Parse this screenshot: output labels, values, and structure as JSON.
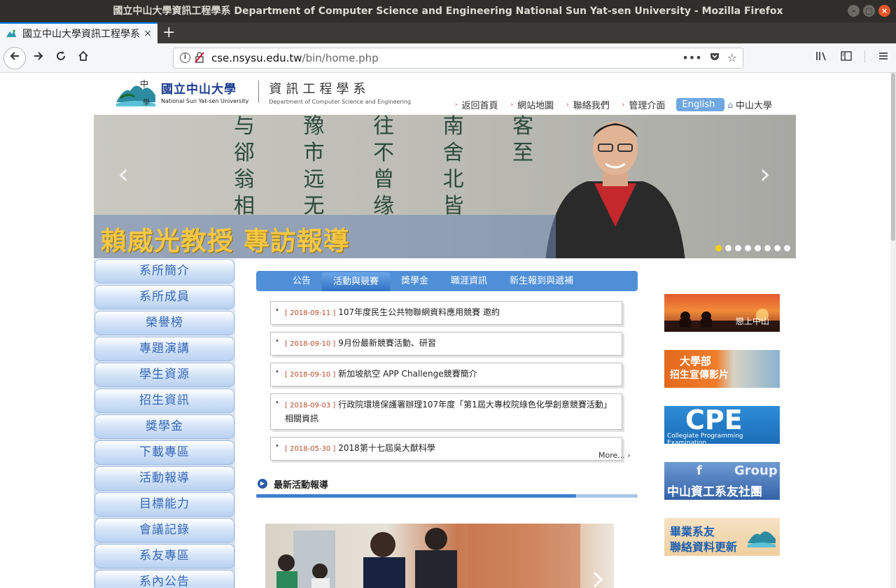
{
  "window": {
    "title": "國立中山大學資訊工程學系 Department of Computer Science and Engineering National Sun Yat-sen University - Mozilla Firefox"
  },
  "browser": {
    "tab_title": "國立中山大學資訊工程學系",
    "url_host": "cse.nsysu.edu.tw",
    "url_path": "/bin/home.php"
  },
  "header": {
    "univ_zh": "國立中山大學",
    "univ_en": "National Sun Yat-sen University",
    "dept_zh": "資訊工程學系",
    "dept_en": "Department of Computer Science and Engineering",
    "links": [
      "返回首頁",
      "網站地圖",
      "聯絡我們",
      "管理介面"
    ],
    "english": "English",
    "nsysu": "中山大學"
  },
  "banner": {
    "caption": "賴威光教授 專訪報導",
    "carving": "与 豫 往 南 客\n郤 市 不 舍 至\n翁 远 曾 北\n相 无 缘 皆",
    "dots_total": 8,
    "active_dot": 1
  },
  "sidebar": {
    "items": [
      "系所簡介",
      "系所成員",
      "榮譽榜",
      "專題演講",
      "學生資源",
      "招生資訊",
      "獎學金",
      "下載專區",
      "活動報導",
      "目標能力",
      "會議記錄",
      "系友專區",
      "系內公告"
    ]
  },
  "tabs": [
    "公告",
    "活動與競賽",
    "獎學金",
    "職涯資訊",
    "新生報到與遞補"
  ],
  "active_tab": 1,
  "news": [
    {
      "date": "[ 2018-09-11 ]",
      "title": "107年度民生公共物聯網資料應用競賽 邀約"
    },
    {
      "date": "[ 2018-09-10 ]",
      "title": "9月份最新競賽活動、研習"
    },
    {
      "date": "[ 2018-09-10 ]",
      "title": "新加坡航空 APP Challenge競賽簡介"
    },
    {
      "date": "[ 2018-09-03 ]",
      "title": "行政院環境保護署辦理107年度「第1屆大專校院綠色化學創意競賽活動」相關資訊"
    },
    {
      "date": "[ 2018-05-30 ]",
      "title": "2018第十七屆吳大猷科學"
    }
  ],
  "more": "More...",
  "section_title": "最新活動報導",
  "ads": {
    "ad1": "戀上中山",
    "ad2_line1": "大學部",
    "ad2_line2": "招生宣傳影片",
    "ad3_big": "CPE",
    "ad3_small": "Collegiate Programming Examination",
    "ad4_top": "Group",
    "ad4_bottom": "中山資工系友社團",
    "ad5_line1": "畢業系友",
    "ad5_line2": "聯絡資料更新"
  }
}
